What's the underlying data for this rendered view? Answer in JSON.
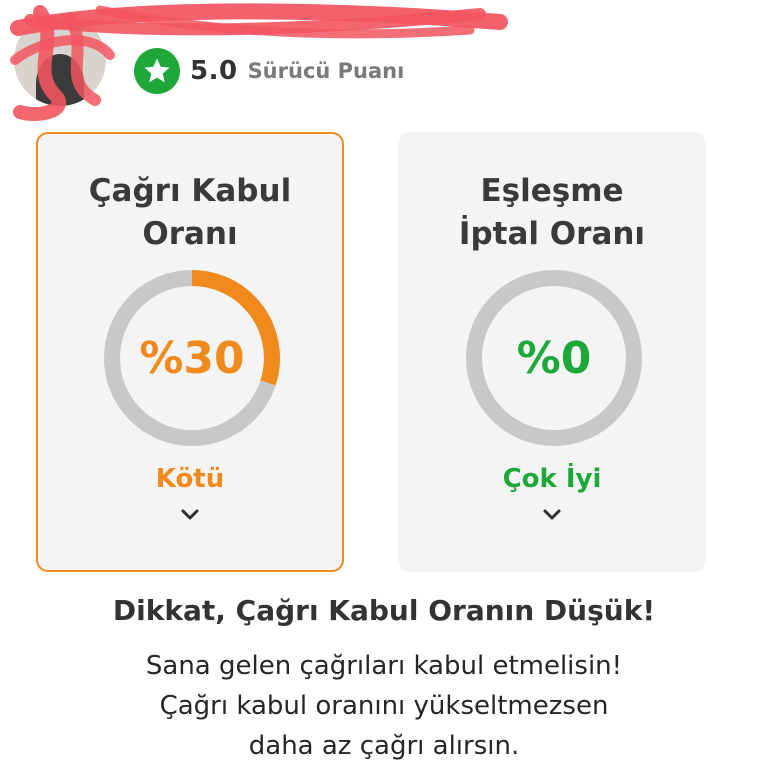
{
  "header": {
    "rating_value": "5.0",
    "rating_caption": "Sürücü Puanı",
    "star_icon": "star-icon"
  },
  "cards": [
    {
      "title_line1": "Çağrı Kabul",
      "title_line2": "Oranı",
      "value_text": "%30",
      "percent": 30,
      "status": "Kötü",
      "color": "#f08a1c",
      "chevron_icon": "chevron-down-icon"
    },
    {
      "title_line1": "Eşleşme",
      "title_line2": "İptal Oranı",
      "value_text": "%0",
      "percent": 0,
      "status": "Çok İyi",
      "color": "#1fa83a",
      "chevron_icon": "chevron-down-icon"
    }
  ],
  "warning": {
    "title": "Dikkat, Çağrı Kabul Oranın Düşük!",
    "line1": "Sana gelen çağrıları kabul etmelisin!",
    "line2": "Çağrı kabul oranını yükseltmezsen",
    "line3": "daha az çağrı alırsın."
  },
  "colors": {
    "accent_orange": "#f08a1c",
    "accent_green": "#1fa83a",
    "track_gray": "#c8c8c8",
    "scribble_red": "#f2555f"
  }
}
